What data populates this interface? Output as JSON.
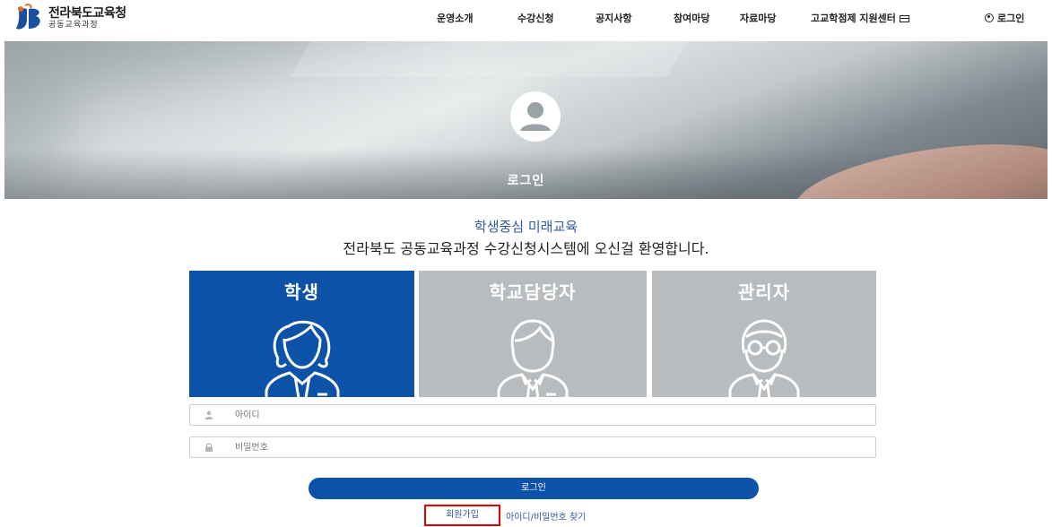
{
  "header": {
    "logo_title": "전라북도교육청",
    "logo_subtitle": "공동교육과정",
    "nav": [
      {
        "label": "운영소개"
      },
      {
        "label": "수강신청"
      },
      {
        "label": "공지사항"
      },
      {
        "label": "참여마당"
      },
      {
        "label": "자료마당"
      },
      {
        "label": "고교학점제 지원센터"
      }
    ],
    "login_label": "로그인"
  },
  "banner": {
    "title": "로그인"
  },
  "welcome": {
    "subtitle": "학생중심 미래교육",
    "title": "전라북도 공동교육과정 수강신청시스템에 오신걸 환영합니다."
  },
  "roles": [
    {
      "label": "학생",
      "selected": true
    },
    {
      "label": "학교담당자",
      "selected": false
    },
    {
      "label": "관리자",
      "selected": false
    }
  ],
  "form": {
    "id_placeholder": "아이디",
    "pw_placeholder": "비밀번호",
    "login_button": "로그인",
    "signup_link": "회원가입",
    "find_link": "아이디/비밀번호 찾기"
  },
  "colors": {
    "primary": "#0b52a8",
    "tile_inactive": "#b9bcbe",
    "link": "#2f5aa0",
    "highlight": "#e00000"
  }
}
